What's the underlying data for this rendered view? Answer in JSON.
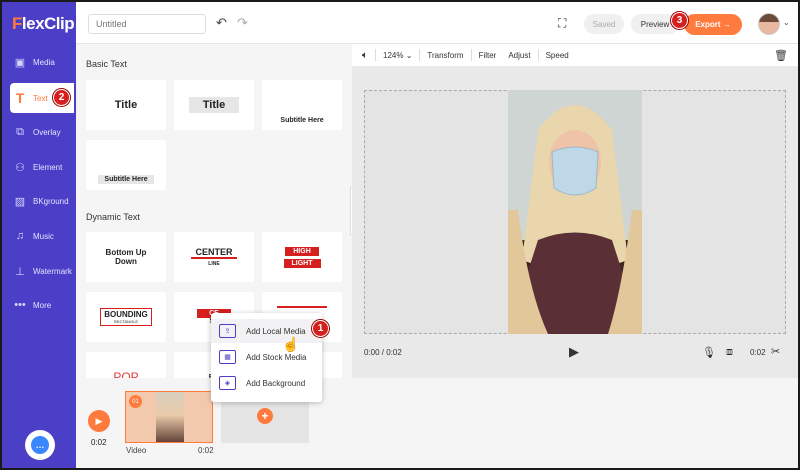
{
  "app": {
    "logo_first": "F",
    "logo_rest": "lexClip"
  },
  "sidebar": {
    "items": [
      {
        "label": "Media",
        "icon": "media-icon"
      },
      {
        "label": "Text",
        "icon": "text-icon"
      },
      {
        "label": "Overlay",
        "icon": "overlay-icon"
      },
      {
        "label": "Element",
        "icon": "element-icon"
      },
      {
        "label": "BKground",
        "icon": "background-icon"
      },
      {
        "label": "Music",
        "icon": "music-icon"
      },
      {
        "label": "Watermark",
        "icon": "watermark-icon"
      },
      {
        "label": "More",
        "icon": "more-icon"
      }
    ]
  },
  "topbar": {
    "title_placeholder": "Untitled",
    "saved_label": "Saved",
    "preview_label": "Preview",
    "export_label": "Export →"
  },
  "panel": {
    "basic_title": "Basic Text",
    "dynamic_title": "Dynamic Text",
    "basic_tiles": [
      "Title",
      "Title",
      "Subtitle Here",
      "Subtitle Here"
    ],
    "dynamic_tiles": [
      {
        "line1": "Bottom Up",
        "line2": "Down"
      },
      {
        "line1": "CENTER",
        "line2": "LINE"
      },
      {
        "line1": "HIGH",
        "line2": "LIGHT"
      },
      {
        "line1": "BOUNDING",
        "line2": "RECTANGLE"
      },
      {
        "line1": "CE",
        "line2": "ST"
      },
      {
        "line1": "POP",
        "line2": ""
      },
      {
        "line1": "BO",
        "line2": ""
      }
    ]
  },
  "toolbar": {
    "zoom": "124%",
    "transform": "Transform",
    "filter": "Filter",
    "adjust": "Adjust",
    "speed": "Speed"
  },
  "player": {
    "current_time": "0:00 / 0:02",
    "duration": "0:02"
  },
  "timeline": {
    "play_time": "0:02",
    "clip_number": "01",
    "clip_label": "Video",
    "clip_duration": "0:02"
  },
  "popup": {
    "items": [
      "Add Local Media",
      "Add Stock Media",
      "Add Background"
    ]
  },
  "badges": [
    "1",
    "2",
    "3"
  ],
  "colors": {
    "brand": "#4a3fc6",
    "accent": "#ff7a3d",
    "badge": "#d62020"
  }
}
